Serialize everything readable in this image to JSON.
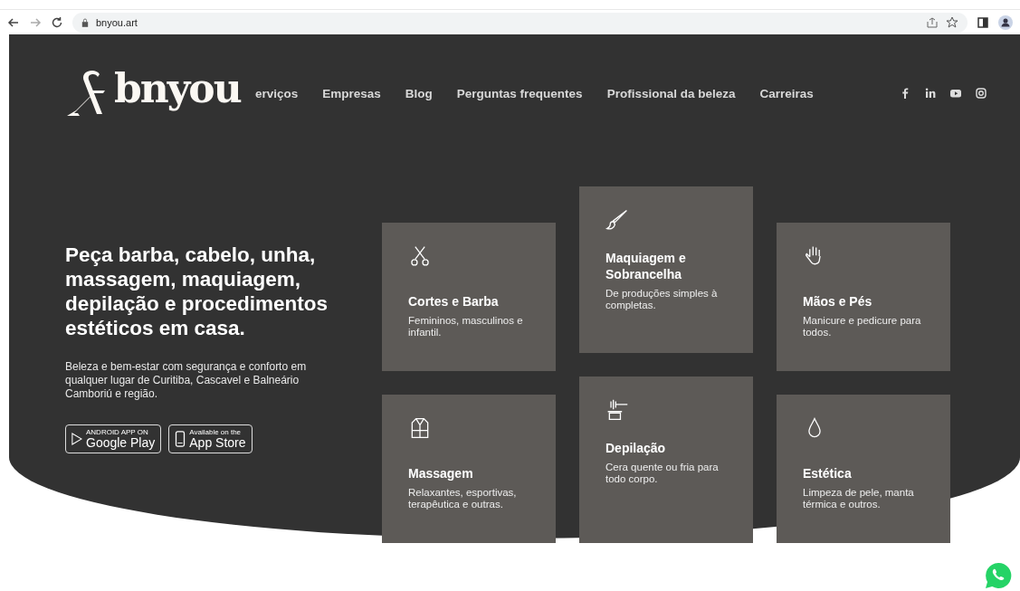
{
  "browser": {
    "url": "bnyou.art"
  },
  "nav": {
    "logo": "bnyou",
    "links": [
      "erviços",
      "Empresas",
      "Blog",
      "Perguntas frequentes",
      "Profissional da beleza",
      "Carreiras"
    ]
  },
  "hero": {
    "heading": "Peça barba, cabelo, unha, massagem, maquiagem, depilação e procedimentos estéticos em casa.",
    "text": "Beleza e bem-estar com segurança e conforto em qualquer lugar de Curitiba, Cascavel e Balneário Camboriú e região.",
    "stores": [
      {
        "kind": "google",
        "small": "ANDROID APP ON",
        "big": "Google Play"
      },
      {
        "kind": "apple",
        "small": "Available on the",
        "big": "App Store"
      }
    ]
  },
  "services": [
    {
      "title": "Cortes e Barba",
      "text": "Femininos, masculinos e infantil."
    },
    {
      "title": "Massagem",
      "text": "Relaxantes, esportivas, terapêutica e outras."
    },
    {
      "title": "Maquiagem e Sobrancelha",
      "text": "De produções simples à completas."
    },
    {
      "title": "Depilação",
      "text": "Cera quente ou fria para todo corpo."
    },
    {
      "title": "Mãos e Pés",
      "text": "Manicure e pedicure para todos."
    },
    {
      "title": "Estética",
      "text": "Limpeza de pele, manta térmica e outros."
    }
  ]
}
